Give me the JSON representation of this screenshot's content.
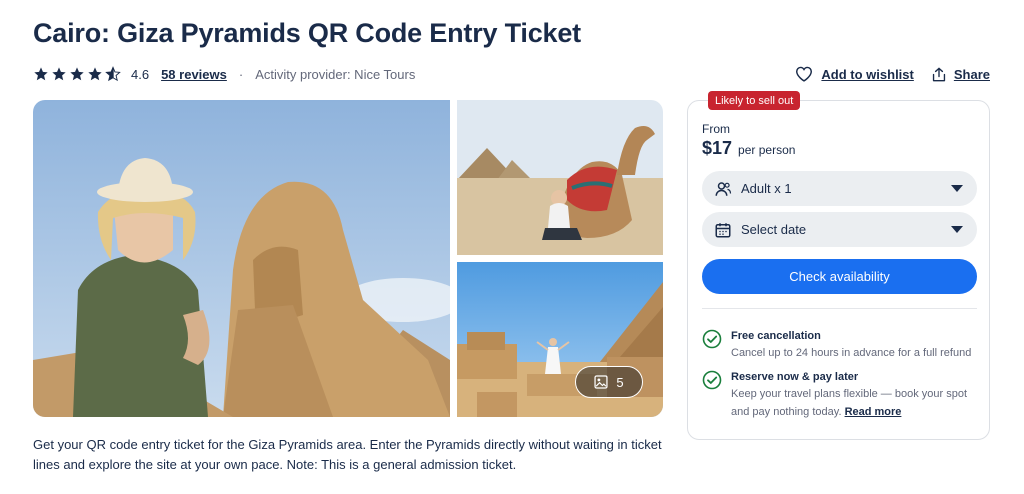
{
  "product": {
    "title": "Cairo: Giza Pyramids QR Code Entry Ticket",
    "rating": "4.6",
    "rating_value": 4.6,
    "rating_max": 5,
    "reviews_label": "58 reviews",
    "separator": "·",
    "provider": "Activity provider: Nice Tours"
  },
  "actions": {
    "wishlist_label": "Add to wishlist",
    "share_label": "Share"
  },
  "gallery": {
    "photo_count": "5"
  },
  "description": "Get your QR code entry ticket for the Giza Pyramids area. Enter the Pyramids directly without waiting in ticket lines and explore the site at your own pace. Note: This is a general admission ticket.",
  "booking": {
    "badge": "Likely to sell out",
    "from_label": "From",
    "price": "$17",
    "per_label": "per person",
    "participants_value": "Adult x 1",
    "date_value": "Select date",
    "cta_label": "Check availability",
    "features": [
      {
        "title": "Free cancellation",
        "description": "Cancel up to 24 hours in advance for a full refund"
      },
      {
        "title": "Reserve now & pay later",
        "description": "Keep your travel plans flexible — book your spot and pay nothing today.",
        "link": "Read more"
      }
    ]
  },
  "colors": {
    "text": "#1a2b49",
    "accent": "#1a6ff0",
    "badge": "#c8242f",
    "check": "#1a7f3c"
  }
}
